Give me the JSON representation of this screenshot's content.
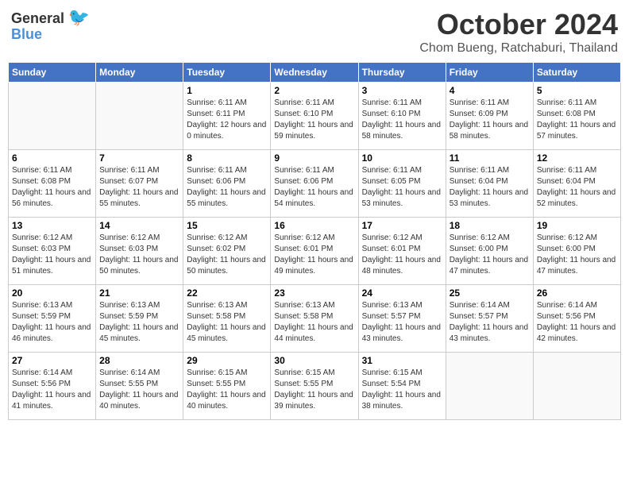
{
  "logo": {
    "general": "General",
    "blue": "Blue"
  },
  "title": "October 2024",
  "subtitle": "Chom Bueng, Ratchaburi, Thailand",
  "weekdays": [
    "Sunday",
    "Monday",
    "Tuesday",
    "Wednesday",
    "Thursday",
    "Friday",
    "Saturday"
  ],
  "weeks": [
    [
      {
        "day": "",
        "sunrise": "",
        "sunset": "",
        "daylight": ""
      },
      {
        "day": "",
        "sunrise": "",
        "sunset": "",
        "daylight": ""
      },
      {
        "day": "1",
        "sunrise": "Sunrise: 6:11 AM",
        "sunset": "Sunset: 6:11 PM",
        "daylight": "Daylight: 12 hours and 0 minutes."
      },
      {
        "day": "2",
        "sunrise": "Sunrise: 6:11 AM",
        "sunset": "Sunset: 6:10 PM",
        "daylight": "Daylight: 11 hours and 59 minutes."
      },
      {
        "day": "3",
        "sunrise": "Sunrise: 6:11 AM",
        "sunset": "Sunset: 6:10 PM",
        "daylight": "Daylight: 11 hours and 58 minutes."
      },
      {
        "day": "4",
        "sunrise": "Sunrise: 6:11 AM",
        "sunset": "Sunset: 6:09 PM",
        "daylight": "Daylight: 11 hours and 58 minutes."
      },
      {
        "day": "5",
        "sunrise": "Sunrise: 6:11 AM",
        "sunset": "Sunset: 6:08 PM",
        "daylight": "Daylight: 11 hours and 57 minutes."
      }
    ],
    [
      {
        "day": "6",
        "sunrise": "Sunrise: 6:11 AM",
        "sunset": "Sunset: 6:08 PM",
        "daylight": "Daylight: 11 hours and 56 minutes."
      },
      {
        "day": "7",
        "sunrise": "Sunrise: 6:11 AM",
        "sunset": "Sunset: 6:07 PM",
        "daylight": "Daylight: 11 hours and 55 minutes."
      },
      {
        "day": "8",
        "sunrise": "Sunrise: 6:11 AM",
        "sunset": "Sunset: 6:06 PM",
        "daylight": "Daylight: 11 hours and 55 minutes."
      },
      {
        "day": "9",
        "sunrise": "Sunrise: 6:11 AM",
        "sunset": "Sunset: 6:06 PM",
        "daylight": "Daylight: 11 hours and 54 minutes."
      },
      {
        "day": "10",
        "sunrise": "Sunrise: 6:11 AM",
        "sunset": "Sunset: 6:05 PM",
        "daylight": "Daylight: 11 hours and 53 minutes."
      },
      {
        "day": "11",
        "sunrise": "Sunrise: 6:11 AM",
        "sunset": "Sunset: 6:04 PM",
        "daylight": "Daylight: 11 hours and 53 minutes."
      },
      {
        "day": "12",
        "sunrise": "Sunrise: 6:11 AM",
        "sunset": "Sunset: 6:04 PM",
        "daylight": "Daylight: 11 hours and 52 minutes."
      }
    ],
    [
      {
        "day": "13",
        "sunrise": "Sunrise: 6:12 AM",
        "sunset": "Sunset: 6:03 PM",
        "daylight": "Daylight: 11 hours and 51 minutes."
      },
      {
        "day": "14",
        "sunrise": "Sunrise: 6:12 AM",
        "sunset": "Sunset: 6:03 PM",
        "daylight": "Daylight: 11 hours and 50 minutes."
      },
      {
        "day": "15",
        "sunrise": "Sunrise: 6:12 AM",
        "sunset": "Sunset: 6:02 PM",
        "daylight": "Daylight: 11 hours and 50 minutes."
      },
      {
        "day": "16",
        "sunrise": "Sunrise: 6:12 AM",
        "sunset": "Sunset: 6:01 PM",
        "daylight": "Daylight: 11 hours and 49 minutes."
      },
      {
        "day": "17",
        "sunrise": "Sunrise: 6:12 AM",
        "sunset": "Sunset: 6:01 PM",
        "daylight": "Daylight: 11 hours and 48 minutes."
      },
      {
        "day": "18",
        "sunrise": "Sunrise: 6:12 AM",
        "sunset": "Sunset: 6:00 PM",
        "daylight": "Daylight: 11 hours and 47 minutes."
      },
      {
        "day": "19",
        "sunrise": "Sunrise: 6:12 AM",
        "sunset": "Sunset: 6:00 PM",
        "daylight": "Daylight: 11 hours and 47 minutes."
      }
    ],
    [
      {
        "day": "20",
        "sunrise": "Sunrise: 6:13 AM",
        "sunset": "Sunset: 5:59 PM",
        "daylight": "Daylight: 11 hours and 46 minutes."
      },
      {
        "day": "21",
        "sunrise": "Sunrise: 6:13 AM",
        "sunset": "Sunset: 5:59 PM",
        "daylight": "Daylight: 11 hours and 45 minutes."
      },
      {
        "day": "22",
        "sunrise": "Sunrise: 6:13 AM",
        "sunset": "Sunset: 5:58 PM",
        "daylight": "Daylight: 11 hours and 45 minutes."
      },
      {
        "day": "23",
        "sunrise": "Sunrise: 6:13 AM",
        "sunset": "Sunset: 5:58 PM",
        "daylight": "Daylight: 11 hours and 44 minutes."
      },
      {
        "day": "24",
        "sunrise": "Sunrise: 6:13 AM",
        "sunset": "Sunset: 5:57 PM",
        "daylight": "Daylight: 11 hours and 43 minutes."
      },
      {
        "day": "25",
        "sunrise": "Sunrise: 6:14 AM",
        "sunset": "Sunset: 5:57 PM",
        "daylight": "Daylight: 11 hours and 43 minutes."
      },
      {
        "day": "26",
        "sunrise": "Sunrise: 6:14 AM",
        "sunset": "Sunset: 5:56 PM",
        "daylight": "Daylight: 11 hours and 42 minutes."
      }
    ],
    [
      {
        "day": "27",
        "sunrise": "Sunrise: 6:14 AM",
        "sunset": "Sunset: 5:56 PM",
        "daylight": "Daylight: 11 hours and 41 minutes."
      },
      {
        "day": "28",
        "sunrise": "Sunrise: 6:14 AM",
        "sunset": "Sunset: 5:55 PM",
        "daylight": "Daylight: 11 hours and 40 minutes."
      },
      {
        "day": "29",
        "sunrise": "Sunrise: 6:15 AM",
        "sunset": "Sunset: 5:55 PM",
        "daylight": "Daylight: 11 hours and 40 minutes."
      },
      {
        "day": "30",
        "sunrise": "Sunrise: 6:15 AM",
        "sunset": "Sunset: 5:55 PM",
        "daylight": "Daylight: 11 hours and 39 minutes."
      },
      {
        "day": "31",
        "sunrise": "Sunrise: 6:15 AM",
        "sunset": "Sunset: 5:54 PM",
        "daylight": "Daylight: 11 hours and 38 minutes."
      },
      {
        "day": "",
        "sunrise": "",
        "sunset": "",
        "daylight": ""
      },
      {
        "day": "",
        "sunrise": "",
        "sunset": "",
        "daylight": ""
      }
    ]
  ]
}
